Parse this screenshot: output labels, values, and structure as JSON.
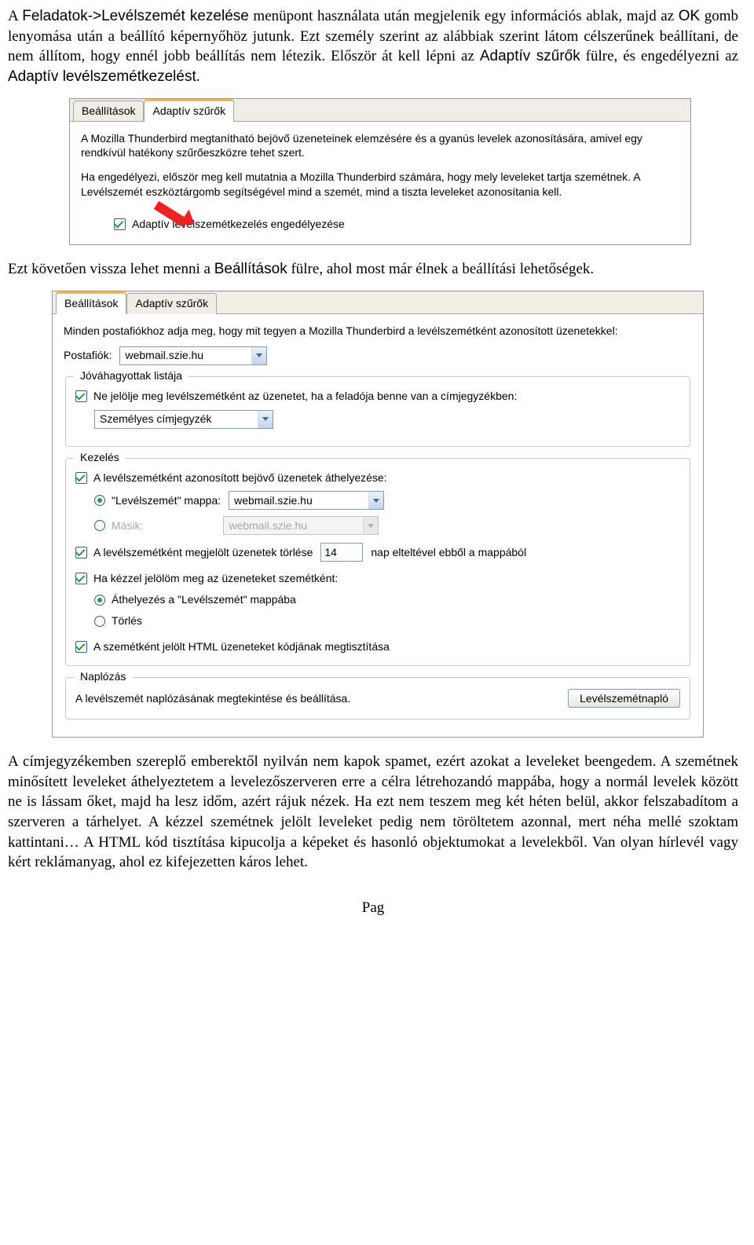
{
  "para1": {
    "a": "A ",
    "menu": "Feladatok->Levélszemét kezelése",
    "b": " menüpont használata után megjelenik egy információs ablak, majd az ",
    "ok": "OK",
    "c": " gomb lenyomása után a beállító képernyőhöz jutunk. Ezt személy szerint az alábbiak szerint látom célszerűnek beállítani, de nem állítom, hogy ennél jobb beállítás nem létezik. Először át kell lépni az ",
    "tab": "Adaptív szűrők",
    "d": " fülre, és engedélyezni az ",
    "opt": "Adaptív levélszemétkezelést",
    "e": "."
  },
  "dlg1": {
    "tabs": {
      "settings": "Beállítások",
      "adaptive": "Adaptív szűrők"
    },
    "text1": "A Mozilla Thunderbird megtanítható bejövő üzeneteinek elemzésére és a gyanús levelek azonosítására, amivel egy rendkívül hatékony szűrőeszközre tehet szert.",
    "text2": "Ha engedélyezi, először meg kell mutatnia a Mozilla Thunderbird számára, hogy mely leveleket tartja szemétnek. A Levélszemét eszköztárgomb segítségével mind a szemét, mind a tiszta leveleket azonosítania kell.",
    "checkbox": "Adaptív levélszemétkezelés engedélyezése"
  },
  "para2": {
    "a": "Ezt követően vissza lehet menni a ",
    "tab": "Beállítások",
    "b": " fülre, ahol most már élnek a beállítási lehetőségek."
  },
  "dlg2": {
    "tabs": {
      "settings": "Beállítások",
      "adaptive": "Adaptív szűrők"
    },
    "intro": "Minden postafiókhoz adja meg, hogy mit tegyen a Mozilla Thunderbird a levélszemétként azonosított üzenetekkel:",
    "accountLabel": "Postafiók:",
    "accountValue": "webmail.szie.hu",
    "whitelist": {
      "legend": "Jóváhagyottak listája",
      "check": "Ne jelölje meg levélszemétként az üzenetet, ha a feladója benne van a címjegyzékben:",
      "select": "Személyes címjegyzék"
    },
    "handling": {
      "legend": "Kezelés",
      "move": "A levélszemétként azonosított bejövő üzenetek áthelyezése:",
      "radioJunk": "\"Levélszemét\" mappa:",
      "radioJunkVal": "webmail.szie.hu",
      "radioOther": "Másik:",
      "radioOtherVal": "webmail.szie.hu",
      "delete1": "A levélszemétként megjelölt üzenetek törlése",
      "deleteDays": "14",
      "delete2": "nap elteltével ebből a mappából",
      "manual": "Ha kézzel jelölöm meg az üzeneteket szemétként:",
      "radioMove": "Áthelyezés a \"Levélszemét\" mappába",
      "radioDel": "Törlés",
      "html": "A szemétként jelölt HTML üzeneteket kódjának megtisztítása"
    },
    "logging": {
      "legend": "Naplózás",
      "text": "A levélszemét naplózásának megtekintése és beállítása.",
      "button": "Levélszemétnapló"
    }
  },
  "para3": "A címjegyzékemben szereplő emberektől nyilván nem kapok spamet, ezért azokat a leveleket beengedem. A szemétnek minősített leveleket áthelyeztetem a levelezőszerveren erre a célra létrehozandó mappába, hogy a normál levelek között ne is lássam őket, majd ha lesz időm, azért rájuk nézek. Ha ezt nem teszem meg két héten belül, akkor felszabadítom a szerveren a tárhelyet. A kézzel szemétnek jelölt leveleket pedig nem töröltetem azonnal, mert néha mellé szoktam kattintani… A HTML kód tisztítása kipucolja a képeket és hasonló objektumokat a levelekből. Van olyan hírlevél vagy kért reklámanyag, ahol ez kifejezetten káros lehet.",
  "footer": "Pag"
}
